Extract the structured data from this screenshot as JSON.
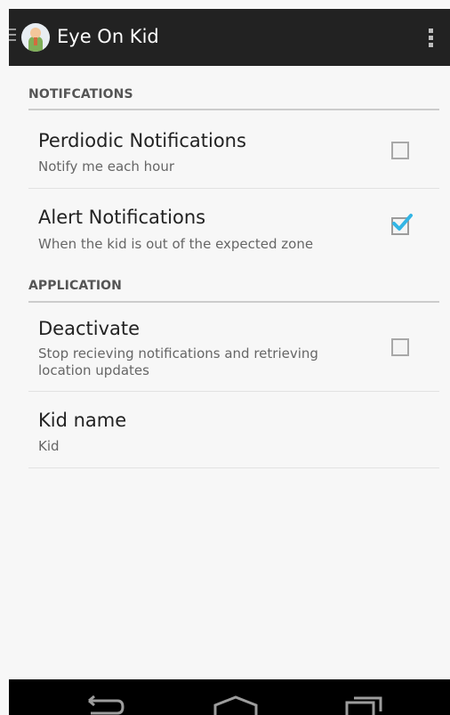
{
  "app": {
    "title": "Eye On Kid"
  },
  "sections": {
    "notifications": {
      "header": "NOTIFCATIONS"
    },
    "application": {
      "header": "APPLICATION"
    }
  },
  "prefs": {
    "periodic": {
      "title": "Perdiodic Notifications",
      "summary": "Notify me each hour",
      "checked": false
    },
    "alert": {
      "title": "Alert Notifications",
      "summary": "When the kid is out of the expected zone",
      "checked": true
    },
    "deactivate": {
      "title": "Deactivate",
      "summary": "Stop recieving notifications and retrieving location updates",
      "checked": false
    },
    "kid_name": {
      "title": "Kid name",
      "summary": "Kid"
    }
  },
  "icons": {
    "drawer": "menu-icon",
    "logo": "kid-logo-icon",
    "overflow": "overflow-menu-icon",
    "back": "back-icon",
    "home": "home-icon",
    "recents": "recents-icon"
  },
  "colors": {
    "actionbar": "#222222",
    "accent": "#33b5e5"
  }
}
